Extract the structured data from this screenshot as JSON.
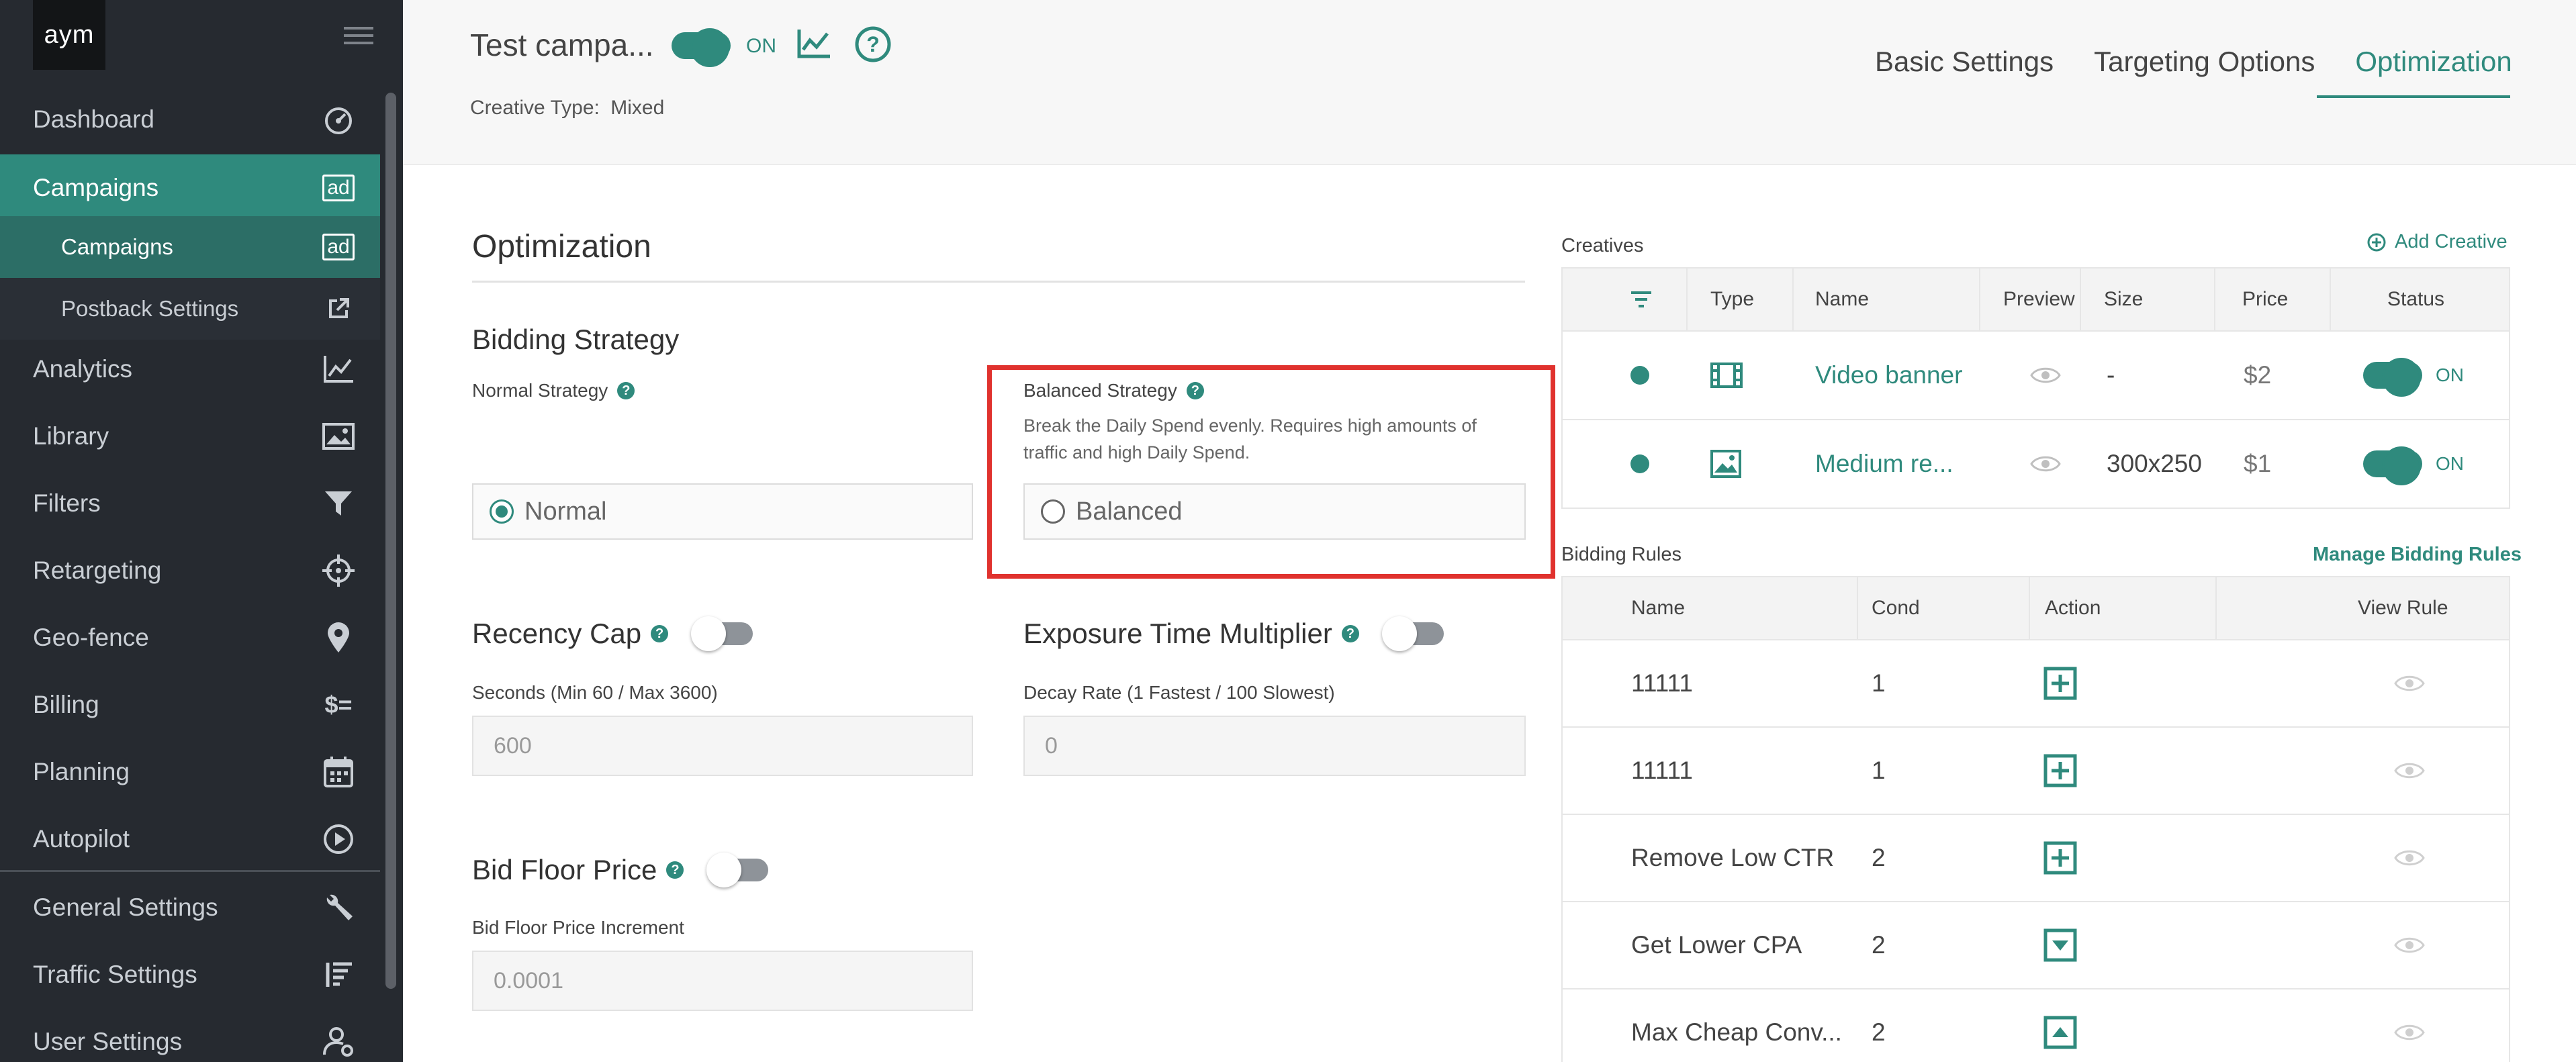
{
  "sidebar": {
    "logo": "aym",
    "items": [
      {
        "label": "Dashboard",
        "icon": "gauge-icon"
      },
      {
        "label": "Campaigns",
        "icon": "ad-icon",
        "icon_text": "ad"
      },
      {
        "label": "Campaigns",
        "icon": "ad-icon",
        "icon_text": "ad"
      },
      {
        "label": "Postback Settings",
        "icon": "external-link-icon"
      },
      {
        "label": "Analytics",
        "icon": "chart-icon"
      },
      {
        "label": "Library",
        "icon": "image-icon"
      },
      {
        "label": "Filters",
        "icon": "funnel-icon"
      },
      {
        "label": "Retargeting",
        "icon": "crosshair-icon"
      },
      {
        "label": "Geo-fence",
        "icon": "map-pin-icon"
      },
      {
        "label": "Billing",
        "icon": "dollar-list-icon",
        "icon_text": "$="
      },
      {
        "label": "Planning",
        "icon": "calendar-icon"
      },
      {
        "label": "Autopilot",
        "icon": "play-circle-icon"
      },
      {
        "label": "General Settings",
        "icon": "wrench-icon"
      },
      {
        "label": "Traffic Settings",
        "icon": "list-sort-icon"
      },
      {
        "label": "User Settings",
        "icon": "user-settings-icon"
      }
    ]
  },
  "header": {
    "campaign_name": "Test campa...",
    "status_toggle": "ON",
    "creative_type_label": "Creative Type:",
    "creative_type_value": "Mixed",
    "tabs": [
      {
        "label": "Basic Settings"
      },
      {
        "label": "Targeting Options"
      },
      {
        "label": "Optimization"
      }
    ],
    "active_tab": "Optimization"
  },
  "optimization": {
    "title": "Optimization",
    "bidding_strategy_title": "Bidding Strategy",
    "normal_strategy_label": "Normal Strategy",
    "normal_option": "Normal",
    "balanced_strategy_label": "Balanced Strategy",
    "balanced_description": "Break the Daily Spend evenly. Requires high amounts of traffic and high Daily Spend.",
    "balanced_option": "Balanced",
    "selected_strategy": "Normal",
    "recency_cap_title": "Recency Cap",
    "recency_seconds_label": "Seconds (Min 60 / Max 3600)",
    "recency_seconds_value": "600",
    "exposure_title": "Exposure Time Multiplier",
    "decay_label": "Decay Rate (1 Fastest / 100 Slowest)",
    "decay_value": "0",
    "bid_floor_title": "Bid Floor Price",
    "bid_floor_increment_label": "Bid Floor Price Increment",
    "bid_floor_increment_value": "0.0001"
  },
  "creatives": {
    "title": "Creatives",
    "add_label": "Add Creative",
    "columns": [
      "Type",
      "Name",
      "Preview",
      "Size",
      "Price",
      "Status"
    ],
    "rows": [
      {
        "type_icon": "film-icon",
        "name": "Video banner",
        "size": "-",
        "price": "$2",
        "status": "ON"
      },
      {
        "type_icon": "image-icon",
        "name": "Medium re...",
        "size": "300x250",
        "price": "$1",
        "status": "ON"
      }
    ]
  },
  "bidding_rules": {
    "title": "Bidding Rules",
    "manage_label": "Manage Bidding Rules",
    "columns": [
      "Name",
      "Cond",
      "Action",
      "View Rule"
    ],
    "rows": [
      {
        "name": "11111",
        "cond": "1",
        "action_icon": "plus-square-icon"
      },
      {
        "name": "11111",
        "cond": "1",
        "action_icon": "plus-square-icon"
      },
      {
        "name": "Remove Low CTR",
        "cond": "2",
        "action_icon": "plus-square-icon"
      },
      {
        "name": "Get Lower CPA",
        "cond": "2",
        "action_icon": "caret-down-square-icon"
      },
      {
        "name": "Max Cheap Conv...",
        "cond": "2",
        "action_icon": "caret-up-square-icon"
      }
    ]
  },
  "colors": {
    "accent": "#2f8a7d",
    "sidebar_bg": "#262a30",
    "highlight_border": "#e0322e"
  }
}
